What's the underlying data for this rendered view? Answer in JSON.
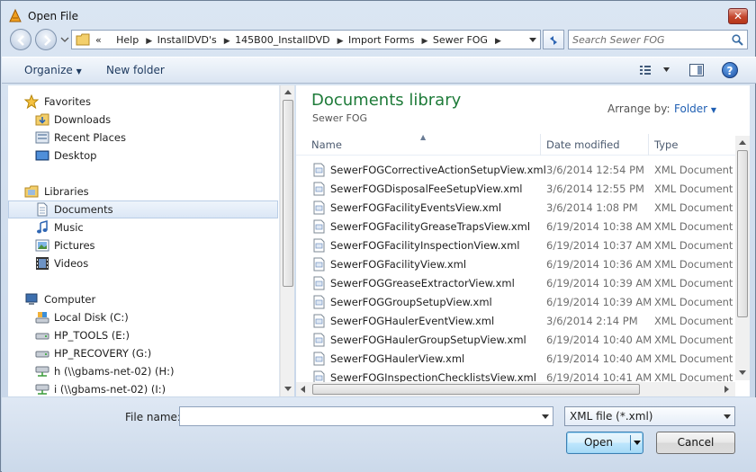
{
  "window": {
    "title": "Open File"
  },
  "nav": {
    "breadcrumbs": [
      "Help",
      "InstallDVD's",
      "145B00_InstallDVD",
      "Import Forms",
      "Sewer FOG"
    ],
    "overflow_marker": "«",
    "search_placeholder": "Search Sewer FOG"
  },
  "toolbar": {
    "organize_label": "Organize",
    "new_folder_label": "New folder",
    "help_label": "?"
  },
  "sidebar": {
    "favorites_label": "Favorites",
    "favorites": [
      "Downloads",
      "Recent Places",
      "Desktop"
    ],
    "libraries_label": "Libraries",
    "libraries": [
      "Documents",
      "Music",
      "Pictures",
      "Videos"
    ],
    "computer_label": "Computer",
    "drives": [
      "Local Disk (C:)",
      "HP_TOOLS (E:)",
      "HP_RECOVERY (G:)",
      "h (\\\\gbams-net-02) (H:)",
      "i (\\\\gbams-net-02) (I:)"
    ]
  },
  "content": {
    "library_title": "Documents library",
    "library_subtitle": "Sewer FOG",
    "arrange_label": "Arrange by:",
    "arrange_value": "Folder",
    "columns": [
      "Name",
      "Date modified",
      "Type"
    ],
    "files": [
      {
        "name": "SewerFOGCorrectiveActionSetupView.xml",
        "date": "3/6/2014 12:54 PM",
        "type": "XML Document"
      },
      {
        "name": "SewerFOGDisposalFeeSetupView.xml",
        "date": "3/6/2014 12:55 PM",
        "type": "XML Document"
      },
      {
        "name": "SewerFOGFacilityEventsView.xml",
        "date": "3/6/2014 1:08 PM",
        "type": "XML Document"
      },
      {
        "name": "SewerFOGFacilityGreaseTrapsView.xml",
        "date": "6/19/2014 10:38 AM",
        "type": "XML Document"
      },
      {
        "name": "SewerFOGFacilityInspectionView.xml",
        "date": "6/19/2014 10:37 AM",
        "type": "XML Document"
      },
      {
        "name": "SewerFOGFacilityView.xml",
        "date": "6/19/2014 10:36 AM",
        "type": "XML Document"
      },
      {
        "name": "SewerFOGGreaseExtractorView.xml",
        "date": "6/19/2014 10:39 AM",
        "type": "XML Document"
      },
      {
        "name": "SewerFOGGroupSetupView.xml",
        "date": "6/19/2014 10:39 AM",
        "type": "XML Document"
      },
      {
        "name": "SewerFOGHaulerEventView.xml",
        "date": "3/6/2014 2:14 PM",
        "type": "XML Document"
      },
      {
        "name": "SewerFOGHaulerGroupSetupView.xml",
        "date": "6/19/2014 10:40 AM",
        "type": "XML Document"
      },
      {
        "name": "SewerFOGHaulerView.xml",
        "date": "6/19/2014 10:40 AM",
        "type": "XML Document"
      },
      {
        "name": "SewerFOGInspectionChecklistsView.xml",
        "date": "6/19/2014 10:41 AM",
        "type": "XML Document"
      }
    ]
  },
  "footer": {
    "file_name_label": "File name:",
    "file_name_value": "",
    "filter_value": "XML file (*.xml)",
    "open_label": "Open",
    "cancel_label": "Cancel"
  },
  "colors": {
    "accent_green": "#1e7b39",
    "link_blue": "#1f5fb3",
    "selection_border": "#b9cde6"
  },
  "icons": {
    "favorites": "star-icon",
    "downloads": "downloads-folder-icon",
    "recent": "recent-places-icon",
    "desktop": "desktop-icon",
    "libraries": "libraries-icon",
    "documents": "documents-icon",
    "music": "music-icon",
    "pictures": "pictures-icon",
    "videos": "videos-icon",
    "computer": "computer-icon",
    "drive": "drive-icon",
    "network_drive": "network-drive-icon",
    "file": "xml-file-icon"
  }
}
